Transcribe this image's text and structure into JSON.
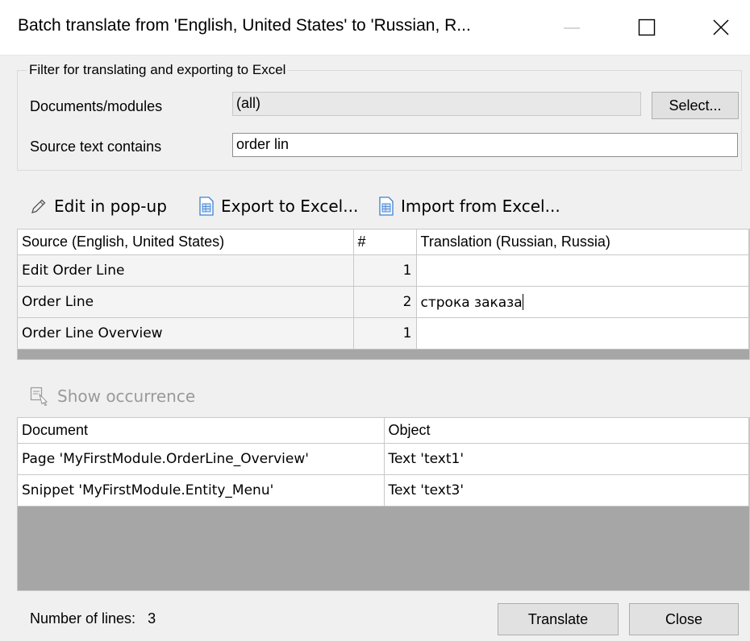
{
  "window": {
    "title": "Batch translate from 'English, United States' to 'Russian, R...",
    "minimize_icon": "minimize-icon",
    "maximize_icon": "maximize-icon",
    "close_icon": "close-icon"
  },
  "filter": {
    "legend": "Filter for translating and exporting to Excel",
    "documents_label": "Documents/modules",
    "documents_value": "(all)",
    "select_button": "Select...",
    "source_text_label": "Source text contains",
    "source_text_value": "order lin"
  },
  "toolbar": {
    "edit_popup": "Edit in pop-up",
    "export_excel": "Export to Excel...",
    "import_excel": "Import from Excel..."
  },
  "translations": {
    "headers": [
      "Source (English, United States)",
      "#",
      "Translation (Russian, Russia)"
    ],
    "rows": [
      {
        "source": "Edit Order Line",
        "count": "1",
        "translation": ""
      },
      {
        "source": "Order Line",
        "count": "2",
        "translation": "строка заказа"
      },
      {
        "source": "Order Line Overview",
        "count": "1",
        "translation": ""
      }
    ]
  },
  "occurrences": {
    "show_button": "Show occurrence",
    "headers": [
      "Document",
      "Object"
    ],
    "rows": [
      {
        "document": "Page 'MyFirstModule.OrderLine_Overview'",
        "object": "Text 'text1'"
      },
      {
        "document": "Snippet 'MyFirstModule.Entity_Menu'",
        "object": "Text 'text3'"
      }
    ]
  },
  "footer": {
    "lines_label": "Number of lines:",
    "lines_count": "3",
    "translate_button": "Translate",
    "close_button": "Close"
  }
}
